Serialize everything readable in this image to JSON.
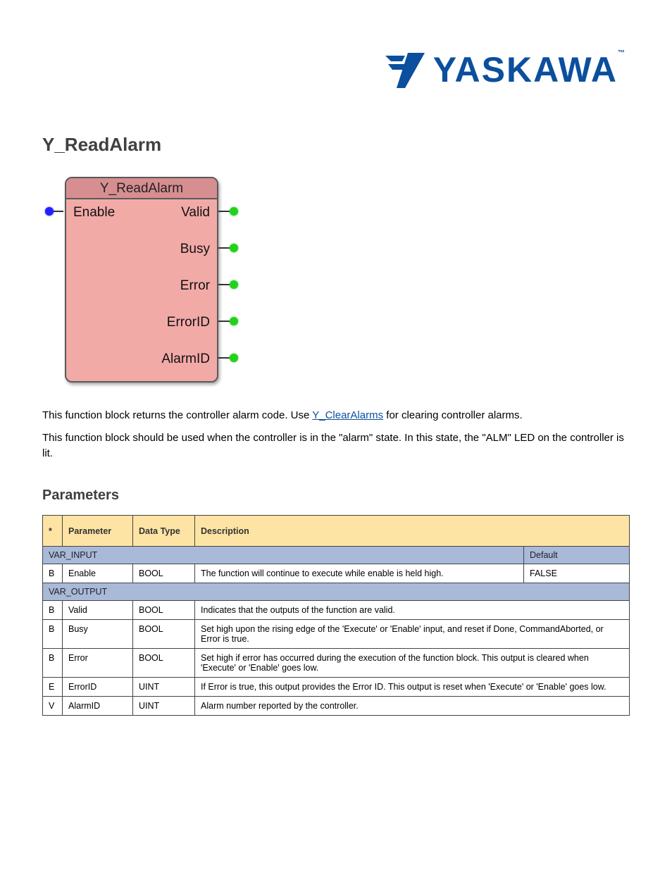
{
  "logo": {
    "text": "YASKAWA",
    "tm": "™"
  },
  "title": "Y_ReadAlarm",
  "fb": {
    "header": "Y_ReadAlarm",
    "left": {
      "enable": "Enable"
    },
    "right": {
      "valid": "Valid",
      "busy": "Busy",
      "error": "Error",
      "errorid": "ErrorID",
      "alarmid": "AlarmID"
    }
  },
  "desc": {
    "line1_a": "This function block returns the controller alarm code.  Use ",
    "link": "Y_ClearAlarms",
    "line1_b": " for clearing controller alarms.",
    "line2": "This function block should be used when the controller is in the \"alarm\" state.  In this state, the \"ALM\" LED on the controller is lit."
  },
  "params_title": "Parameters",
  "table": {
    "headers": {
      "flag": "*",
      "param": "Parameter",
      "type": "Data Type",
      "desc": "Description"
    },
    "var_in": {
      "label": "VAR_INPUT",
      "default_h": "Default"
    },
    "in_rows": [
      {
        "flag": "B",
        "param": "Enable",
        "type": "BOOL",
        "desc": "The function will continue to execute while enable is held high.",
        "default": "FALSE"
      }
    ],
    "var_out": {
      "label": "VAR_OUTPUT"
    },
    "out_rows": [
      {
        "flag": "B",
        "param": "Valid",
        "type": "BOOL",
        "desc": "Indicates that the outputs of the function are valid."
      },
      {
        "flag": "B",
        "param": "Busy",
        "type": "BOOL",
        "desc": "Set high upon the rising edge of the 'Execute' or 'Enable' input, and reset if Done, CommandAborted, or Error is true."
      },
      {
        "flag": "B",
        "param": "Error",
        "type": "BOOL",
        "desc": "Set high if error has occurred during the execution of the function block.  This output is cleared when 'Execute' or 'Enable' goes low."
      },
      {
        "flag": "E",
        "param": "ErrorID",
        "type": "UINT",
        "desc": "If Error is true, this output provides the Error ID.  This output is reset when 'Execute' or 'Enable' goes low."
      },
      {
        "flag": "V",
        "param": "AlarmID",
        "type": "UINT",
        "desc": "Alarm number reported by the controller."
      }
    ]
  }
}
